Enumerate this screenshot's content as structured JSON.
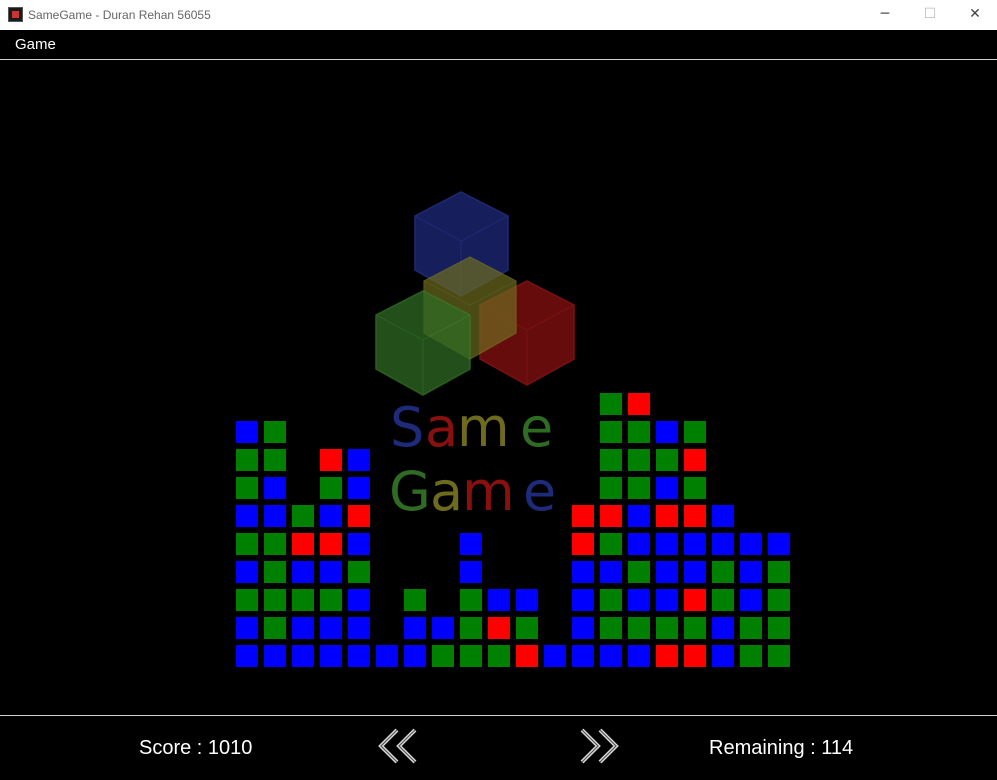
{
  "window": {
    "title": "SameGame - Duran Rehan 56055",
    "minimize_glyph": "─",
    "maximize_glyph": "☐",
    "close_glyph": "✕"
  },
  "menu": {
    "items": [
      "Game"
    ]
  },
  "logo": {
    "line1": [
      "S",
      "a",
      "m",
      "e"
    ],
    "line2": [
      "G",
      "a",
      "m",
      "e"
    ]
  },
  "colors": {
    "B": "#0000ff",
    "G": "#008000",
    "R": "#ff0000",
    "background": "#000000",
    "logo_blue": "#1e2a7a",
    "logo_green": "#2f6b23",
    "logo_red": "#8a1010",
    "logo_olive": "#6e6b1f"
  },
  "board": {
    "columns": [
      [
        "B",
        "B",
        "G",
        "B",
        "G",
        "B",
        "G",
        "G",
        "B"
      ],
      [
        "B",
        "G",
        "G",
        "G",
        "G",
        "B",
        "B",
        "G",
        "G"
      ],
      [
        "B",
        "B",
        "G",
        "B",
        "R",
        "G"
      ],
      [
        "B",
        "B",
        "G",
        "B",
        "R",
        "B",
        "G",
        "R"
      ],
      [
        "B",
        "B",
        "B",
        "G",
        "B",
        "R",
        "B",
        "B"
      ],
      [
        "B"
      ],
      [
        "B",
        "B",
        "G"
      ],
      [
        "G",
        "B"
      ],
      [
        "G",
        "G",
        "G",
        "B",
        "B"
      ],
      [
        "G",
        "R",
        "B"
      ],
      [
        "R",
        "G",
        "B"
      ],
      [
        "B"
      ],
      [
        "B",
        "B",
        "B",
        "B",
        "R",
        "R"
      ],
      [
        "B",
        "G",
        "G",
        "B",
        "G",
        "R",
        "G",
        "G",
        "G",
        "G"
      ],
      [
        "B",
        "G",
        "B",
        "G",
        "B",
        "B",
        "G",
        "G",
        "G",
        "R"
      ],
      [
        "R",
        "G",
        "B",
        "B",
        "B",
        "R",
        "B",
        "G",
        "B"
      ],
      [
        "R",
        "G",
        "R",
        "B",
        "B",
        "R",
        "G",
        "R",
        "G"
      ],
      [
        "B",
        "B",
        "G",
        "G",
        "B",
        "B"
      ],
      [
        "G",
        "G",
        "B",
        "B",
        "B"
      ],
      [
        "G",
        "G",
        "G",
        "G",
        "B"
      ]
    ]
  },
  "status": {
    "score": "Score : 1010",
    "remaining": "Remaining : 114"
  },
  "nav": {
    "prev_icon": "double-chevron-left",
    "next_icon": "double-chevron-right"
  }
}
